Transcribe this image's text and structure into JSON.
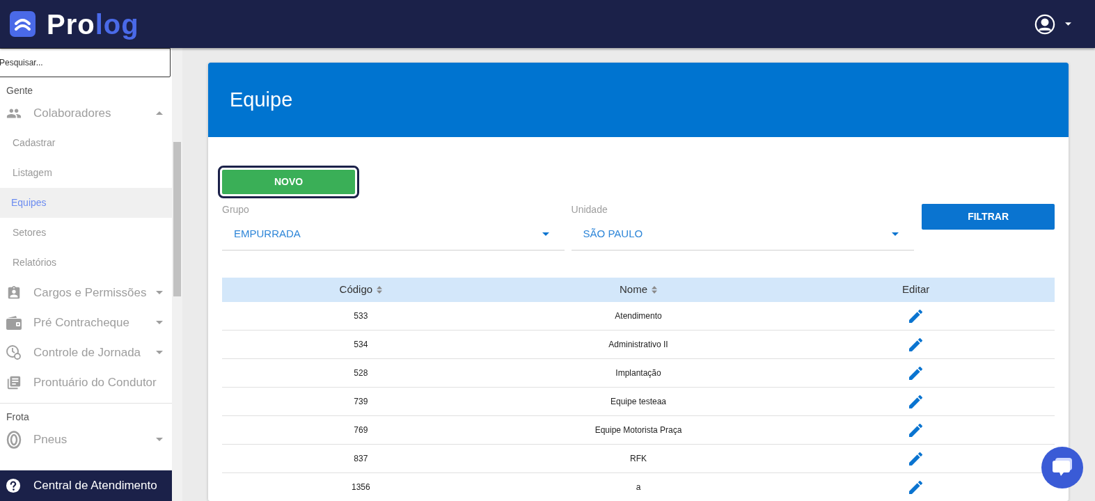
{
  "header": {
    "logo_start": "Pro",
    "logo_end": "log"
  },
  "sidebar": {
    "search": {
      "placeholder": "Pesquisar..."
    },
    "sections": [
      {
        "title": "Gente",
        "items": [
          {
            "label": "Colaboradores",
            "kind": "people",
            "expanded": true,
            "children": [
              {
                "label": "Cadastrar",
                "selected": false
              },
              {
                "label": "Listagem",
                "selected": false
              },
              {
                "label": "Equipes",
                "selected": true
              },
              {
                "label": "Setores",
                "selected": false
              },
              {
                "label": "Relatórios",
                "selected": false
              }
            ]
          },
          {
            "label": "Cargos e Permissões",
            "kind": "badge",
            "expanded": false
          },
          {
            "label": "Pré Contracheque",
            "kind": "wallet",
            "expanded": false
          },
          {
            "label": "Controle de Jornada",
            "kind": "clock",
            "expanded": false
          },
          {
            "label": "Prontuário do Condutor",
            "kind": "docs"
          }
        ]
      },
      {
        "title": "Frota",
        "items": [
          {
            "label": "Pneus",
            "kind": "tire",
            "expanded": false
          }
        ]
      }
    ],
    "footer": "Central de Atendimento"
  },
  "card": {
    "title": "Equipe",
    "new_button": "NOVO",
    "filters": [
      {
        "label": "Grupo",
        "value": "EMPURRADA"
      },
      {
        "label": "Unidade",
        "value": "SÃO PAULO"
      }
    ],
    "filter_button": "FILTRAR",
    "table": {
      "columns": [
        {
          "label": "Código",
          "sortable": true
        },
        {
          "label": "Nome",
          "sortable": true
        },
        {
          "label": "Editar",
          "sortable": false
        }
      ],
      "rows": [
        [
          "533",
          "Atendimento"
        ],
        [
          "534",
          "Administrativo II"
        ],
        [
          "528",
          "Implantação"
        ],
        [
          "739",
          "Equipe testeaa"
        ],
        [
          "769",
          "Equipe Motorista Praça"
        ],
        [
          "837",
          "RFK"
        ],
        [
          "1356",
          "a"
        ]
      ]
    }
  }
}
